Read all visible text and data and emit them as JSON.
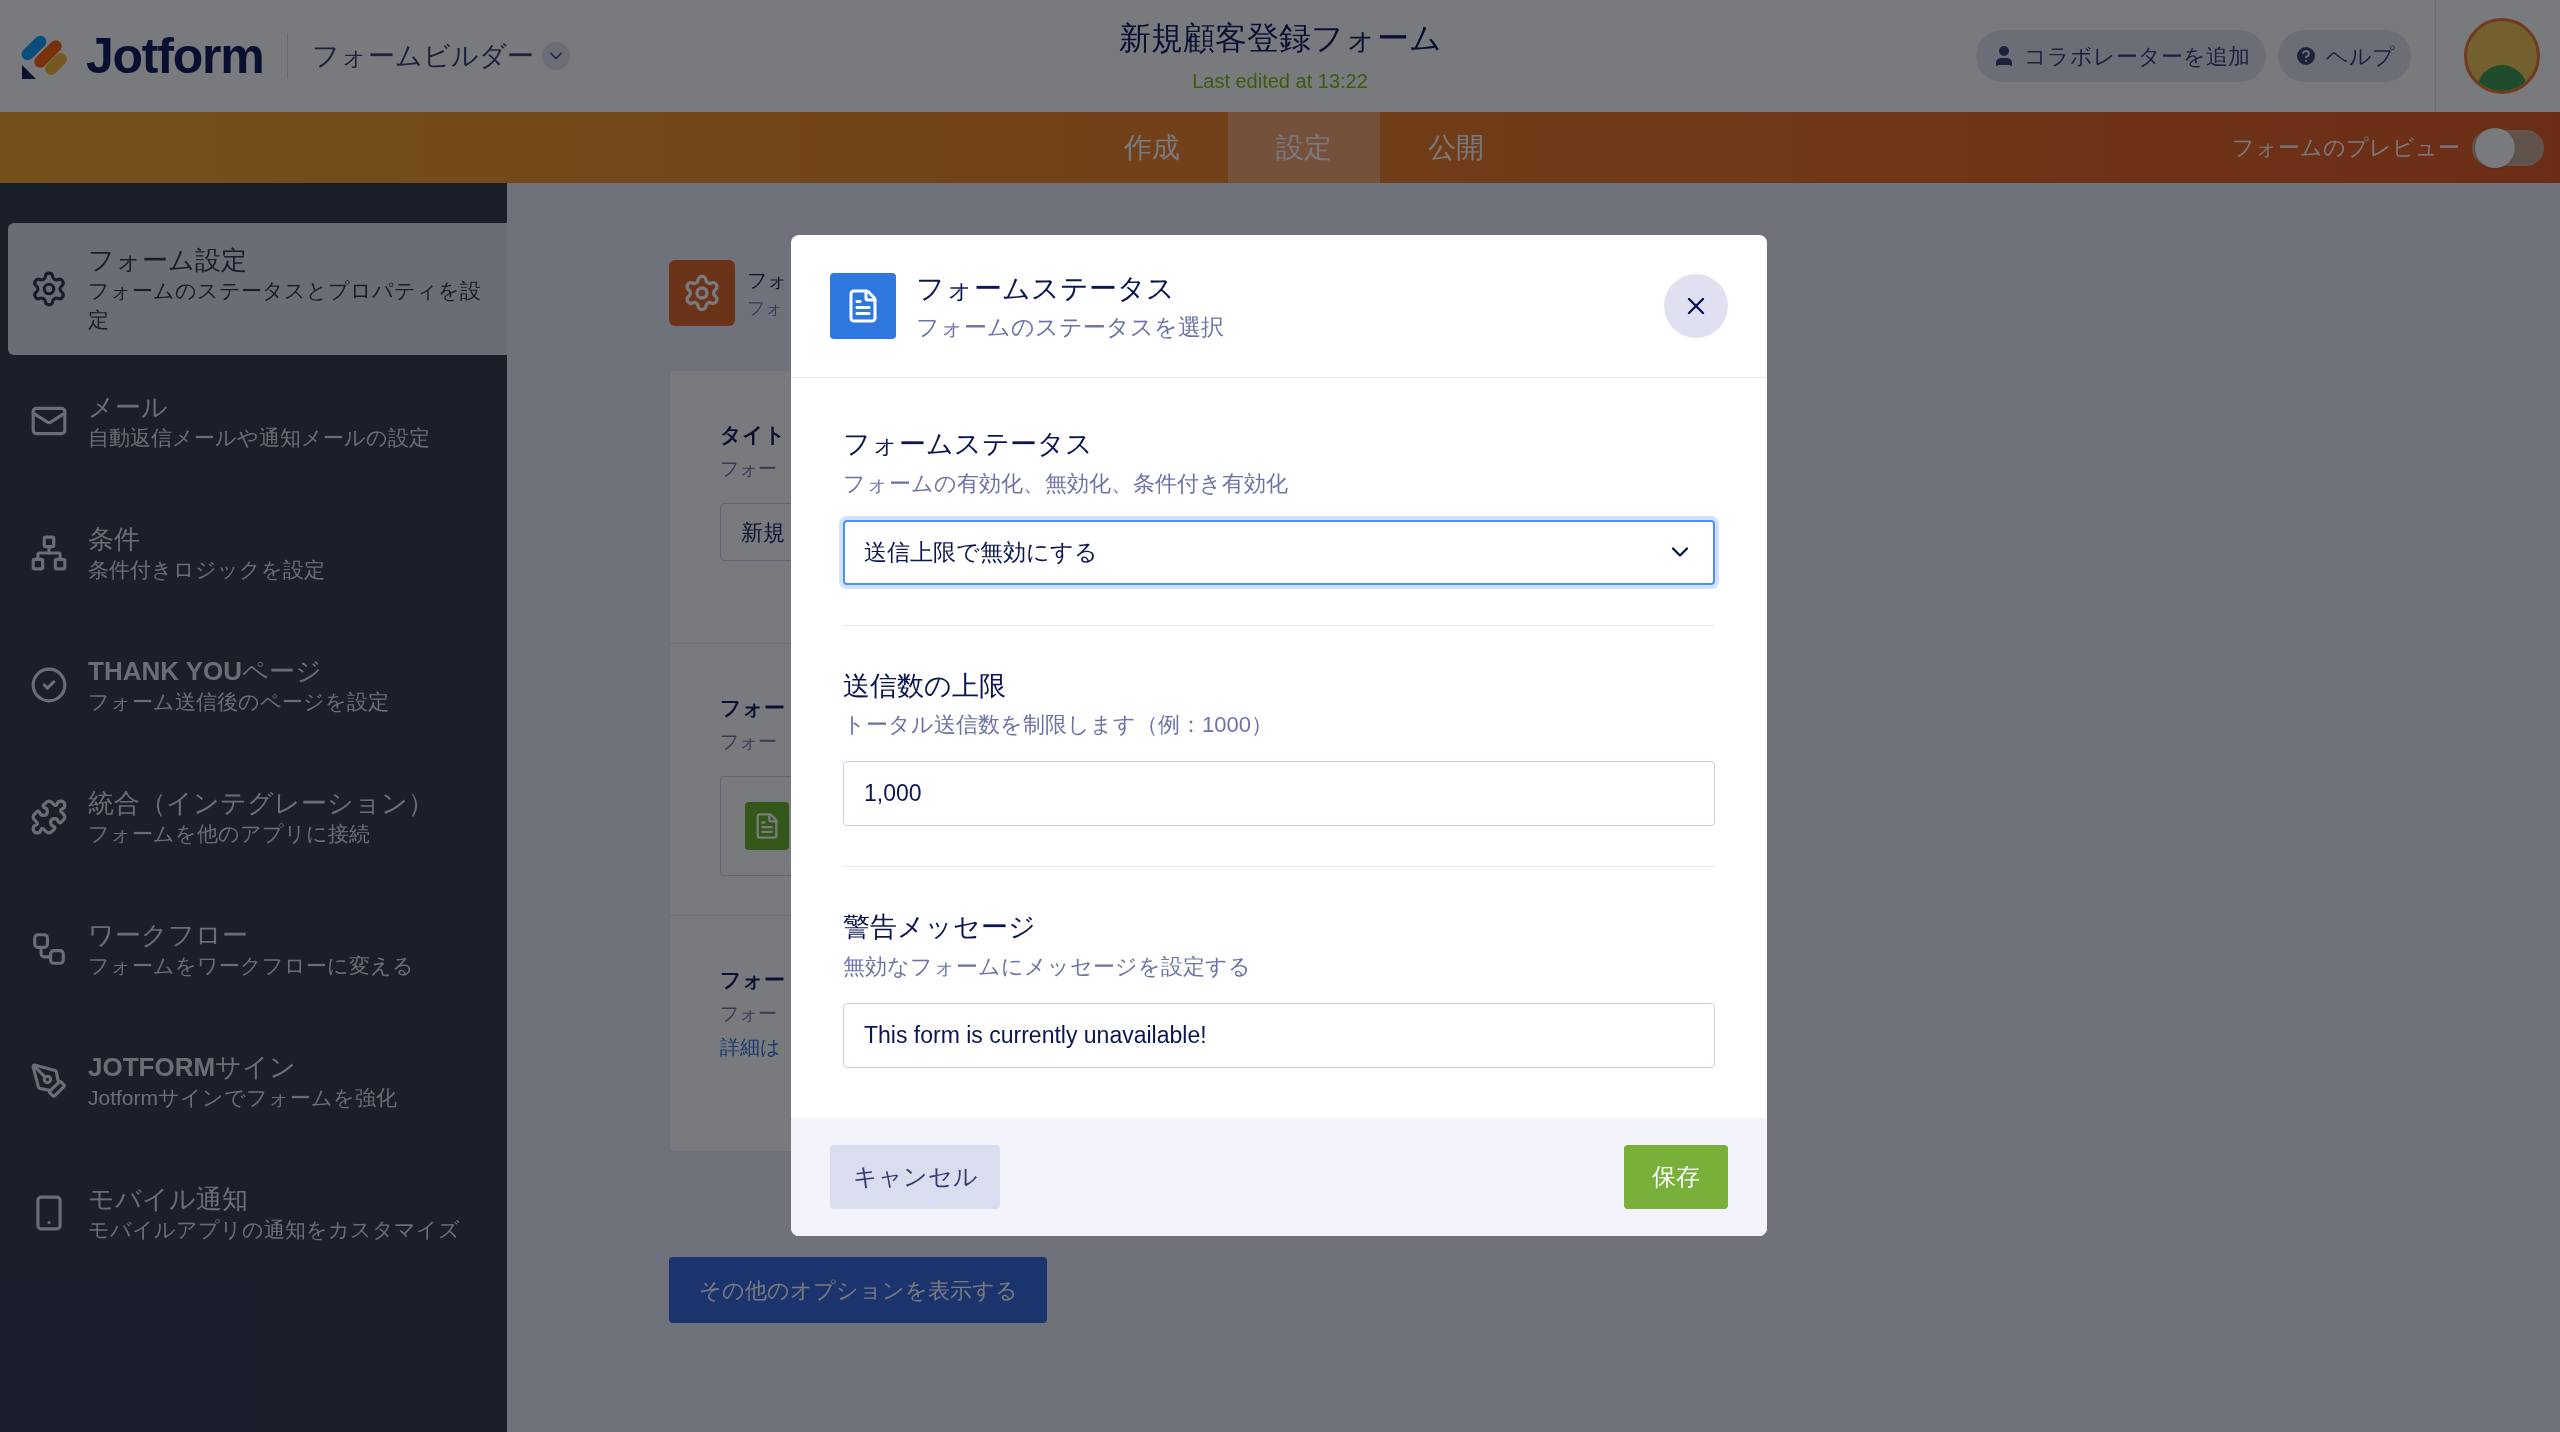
{
  "header": {
    "logo": "Jotform",
    "builder_menu": "フォームビルダー",
    "form_title": "新規顧客登録フォーム",
    "last_edited": "Last edited at 13:22",
    "buttons": [
      {
        "label": "コラボレーターを追加",
        "kind": "user"
      },
      {
        "label": "ヘルプ",
        "kind": "help"
      }
    ]
  },
  "nav_tabs": [
    {
      "label": "作成",
      "selected": false
    },
    {
      "label": "設定",
      "selected": true
    },
    {
      "label": "公開",
      "selected": false
    }
  ],
  "preview": {
    "label": "フォームのプレビュー",
    "on": false
  },
  "sidebar": {
    "items": [
      {
        "title": "フォーム設定",
        "subtitle": "フォームのステータスとプロパティを設定",
        "selected": true
      },
      {
        "title": "メール",
        "subtitle": "自動返信メールや通知メールの設定",
        "selected": false
      },
      {
        "title": "条件",
        "subtitle": "条件付きロジックを設定",
        "selected": false
      },
      {
        "title": "**THANK YOU**ページ",
        "subtitle": "フォーム送信後のページを設定",
        "selected": false
      },
      {
        "title": "統合（インテグレーション）",
        "subtitle": "フォームを他のアプリに接続",
        "selected": false
      },
      {
        "title": "ワークフロー",
        "subtitle": "フォームをワークフローに変える",
        "selected": false
      },
      {
        "title": "**JOTFORM**サイン",
        "subtitle": "Jotformサインでフォームを強化",
        "selected": false
      },
      {
        "title": "モバイル通知",
        "subtitle": "モバイルアプリの通知をカスタマイズ",
        "selected": false
      }
    ]
  },
  "settings": {
    "title": "フォ",
    "subtitle": "フォ",
    "sections": [
      {
        "kind": "input",
        "title": "タイト",
        "subtitle": "フォー",
        "value": "新規"
      },
      {
        "kind": "option",
        "title": "フォー",
        "subtitle": "フォー"
      },
      {
        "kind": "link",
        "title": "フォー",
        "subtitle": "フォー",
        "link": "詳細は"
      }
    ],
    "more_button": "その他のオプションを表示する"
  },
  "modal": {
    "title": "フォームステータス",
    "subtitle": "フォームのステータスを選択",
    "fields": [
      {
        "kind": "select",
        "label": "フォームステータス",
        "hint": "フォームの有効化、無効化、条件付き有効化",
        "value": "送信上限で無効にする"
      },
      {
        "kind": "input",
        "label": "送信数の上限",
        "hint": "トータル送信数を制限します（例：1000）",
        "value": "1,000"
      },
      {
        "kind": "input",
        "label": "警告メッセージ",
        "hint": "無効なフォームにメッセージを設定する",
        "value": "This form is currently unavailable!"
      }
    ],
    "cancel": "キャンセル",
    "save": "保存"
  }
}
